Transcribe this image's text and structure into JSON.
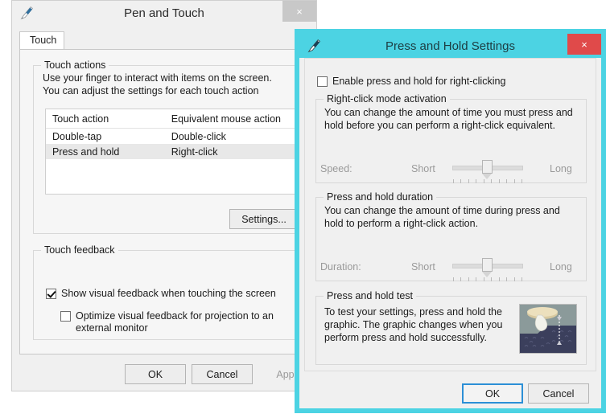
{
  "theme": {
    "active_border": "#4cd3e3",
    "active_close": "#e04a4a",
    "inactive_close": "#c8c8c8",
    "dialog_face": "#f0f0f0",
    "tabpage_face": "#f6f6f6",
    "default_button_focus": "#2c8fd6",
    "disabled_text": "#9a9a9a"
  },
  "pen_and_touch": {
    "title": "Pen and Touch",
    "icon": "pen-icon",
    "close_label": "×",
    "tabs": [
      {
        "label": "Touch",
        "selected": true
      }
    ],
    "touch_actions": {
      "group_title": "Touch actions",
      "description": "Use your finger to interact with items on the screen. You can adjust the settings for each touch action",
      "table": {
        "columns": [
          "Touch action",
          "Equivalent mouse action"
        ],
        "rows": [
          {
            "cells": [
              "Double-tap",
              "Double-click"
            ],
            "selected": false
          },
          {
            "cells": [
              "Press and hold",
              "Right-click"
            ],
            "selected": true
          }
        ]
      },
      "settings_button": "Settings..."
    },
    "touch_feedback": {
      "group_title": "Touch feedback",
      "show_visual_feedback": {
        "label": "Show visual feedback when touching the screen",
        "checked": true
      },
      "optimize_projection": {
        "label": "Optimize visual feedback for projection to an external monitor",
        "checked": false
      }
    },
    "buttons": {
      "ok": "OK",
      "cancel": "Cancel",
      "apply": "Apply",
      "apply_disabled": true
    }
  },
  "press_and_hold": {
    "title": "Press and Hold Settings",
    "icon": "pen-icon",
    "close_label": "×",
    "enable_checkbox": {
      "label": "Enable press and hold for right-clicking",
      "checked": false
    },
    "right_click_mode": {
      "group_title": "Right-click mode activation",
      "description": "You can change the amount of time you must press and hold before you can perform a right-click equivalent.",
      "slider": {
        "name": "Speed:",
        "min_label": "Short",
        "max_label": "Long",
        "value_percent": 50,
        "ticks": 10,
        "disabled": true
      }
    },
    "duration": {
      "group_title": "Press and hold duration",
      "description": "You can change the amount of time during press and hold to perform a right-click action.",
      "slider": {
        "name": "Duration:",
        "min_label": "Short",
        "max_label": "Long",
        "value_percent": 50,
        "ticks": 10,
        "disabled": true
      }
    },
    "test": {
      "group_title": "Press and hold test",
      "description": "To test your settings, press and hold the graphic. The graphic changes when you perform press and hold successfully.",
      "graphic_name": "droplet-test-graphic"
    },
    "buttons": {
      "ok": "OK",
      "cancel": "Cancel",
      "ok_is_default": true
    }
  }
}
